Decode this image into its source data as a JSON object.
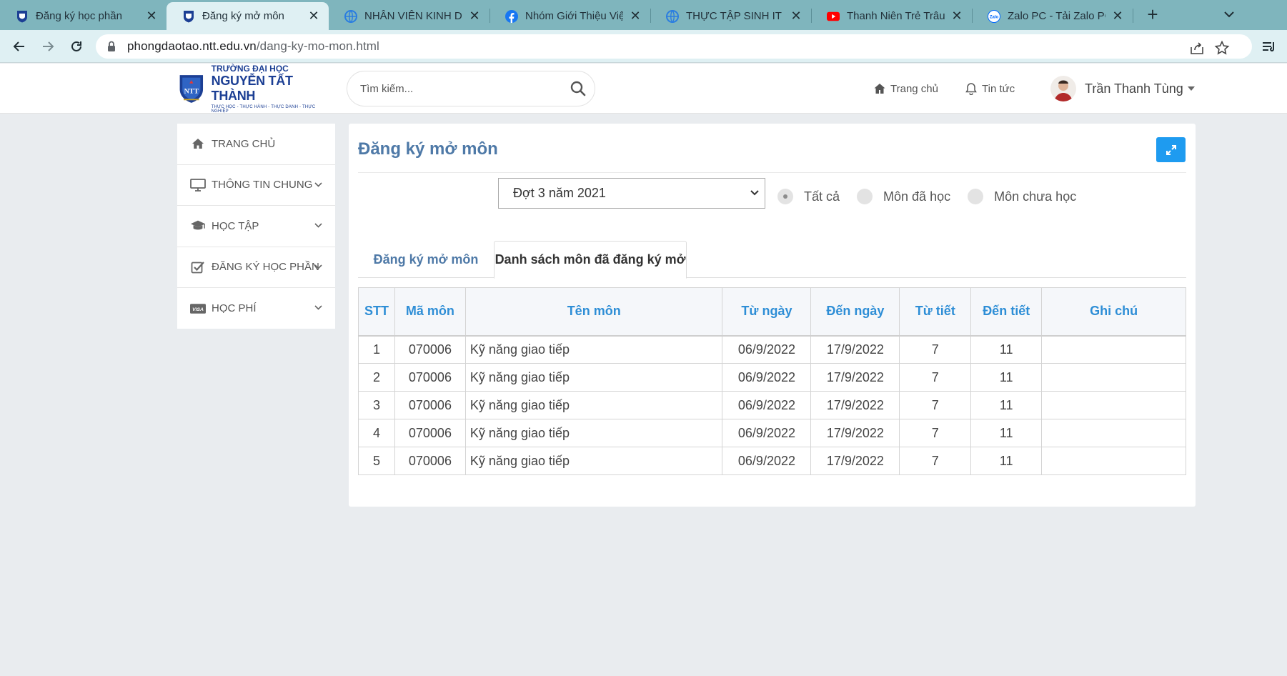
{
  "browser": {
    "tabs": [
      {
        "title": "Đăng ký học phần",
        "icon": "school-logo-icon"
      },
      {
        "title": "Đăng ký mở môn",
        "icon": "school-logo-icon",
        "active": true
      },
      {
        "title": "NHÂN VIÊN KINH DO",
        "icon": "globe-icon"
      },
      {
        "title": "Nhóm Giới Thiệu Việc",
        "icon": "facebook-icon"
      },
      {
        "title": "THỰC TẬP SINH IT - C",
        "icon": "globe-icon"
      },
      {
        "title": "Thanh Niên Trẻ Trâu L",
        "icon": "youtube-icon"
      },
      {
        "title": "Zalo PC - Tải Zalo PC",
        "icon": "zalo-icon"
      }
    ],
    "url_host": "phongdaotao.ntt.edu.vn",
    "url_path": "/dang-ky-mo-mon.html"
  },
  "header": {
    "logo_line1": "TRƯỜNG ĐẠI HỌC",
    "logo_line2": "NGUYỄN TẤT THÀNH",
    "logo_line3": "THỰC HỌC - THỰC HÀNH - THỰC DANH - THỰC NGHIỆP",
    "search_placeholder": "Tìm kiếm...",
    "nav_home": "Trang chủ",
    "nav_news": "Tin tức",
    "user_name": "Trần Thanh Tùng"
  },
  "sidebar": {
    "items": [
      {
        "label": "TRANG CHỦ",
        "icon": "home-icon",
        "has_children": false
      },
      {
        "label": "THÔNG TIN CHUNG",
        "icon": "monitor-icon",
        "has_children": true
      },
      {
        "label": "HỌC TẬP",
        "icon": "graduation-cap-icon",
        "has_children": true
      },
      {
        "label": "ĐĂNG KÝ HỌC PHẦN",
        "icon": "checkbox-icon",
        "has_children": true
      },
      {
        "label": "HỌC PHÍ",
        "icon": "visa-card-icon",
        "has_children": true
      }
    ]
  },
  "main": {
    "title": "Đăng ký mở môn",
    "semester_select": "Đợt 3 năm 2021",
    "filters": [
      {
        "label": "Tất cả",
        "checked": true
      },
      {
        "label": "Môn đã học",
        "checked": false
      },
      {
        "label": "Môn chưa học",
        "checked": false
      }
    ],
    "tabs": [
      {
        "label": "Đăng ký mở môn",
        "active": false
      },
      {
        "label": "Danh sách môn đã đăng ký mở",
        "active": true
      }
    ],
    "table": {
      "headers": [
        "STT",
        "Mã môn",
        "Tên môn",
        "Từ ngày",
        "Đến ngày",
        "Từ tiết",
        "Đến tiết",
        "Ghi chú"
      ],
      "rows": [
        [
          "1",
          "070006",
          "Kỹ năng giao tiếp",
          "06/9/2022",
          "17/9/2022",
          "7",
          "11",
          ""
        ],
        [
          "2",
          "070006",
          "Kỹ năng giao tiếp",
          "06/9/2022",
          "17/9/2022",
          "7",
          "11",
          ""
        ],
        [
          "3",
          "070006",
          "Kỹ năng giao tiếp",
          "06/9/2022",
          "17/9/2022",
          "7",
          "11",
          ""
        ],
        [
          "4",
          "070006",
          "Kỹ năng giao tiếp",
          "06/9/2022",
          "17/9/2022",
          "7",
          "11",
          ""
        ],
        [
          "5",
          "070006",
          "Kỹ năng giao tiếp",
          "06/9/2022",
          "17/9/2022",
          "7",
          "11",
          ""
        ]
      ]
    }
  },
  "colors": {
    "accent_blue": "#1e9bf0",
    "title_blue": "#4e79a7",
    "header_blue": "#2e8ed6",
    "browser_tabbar": "#7fb5bd"
  }
}
